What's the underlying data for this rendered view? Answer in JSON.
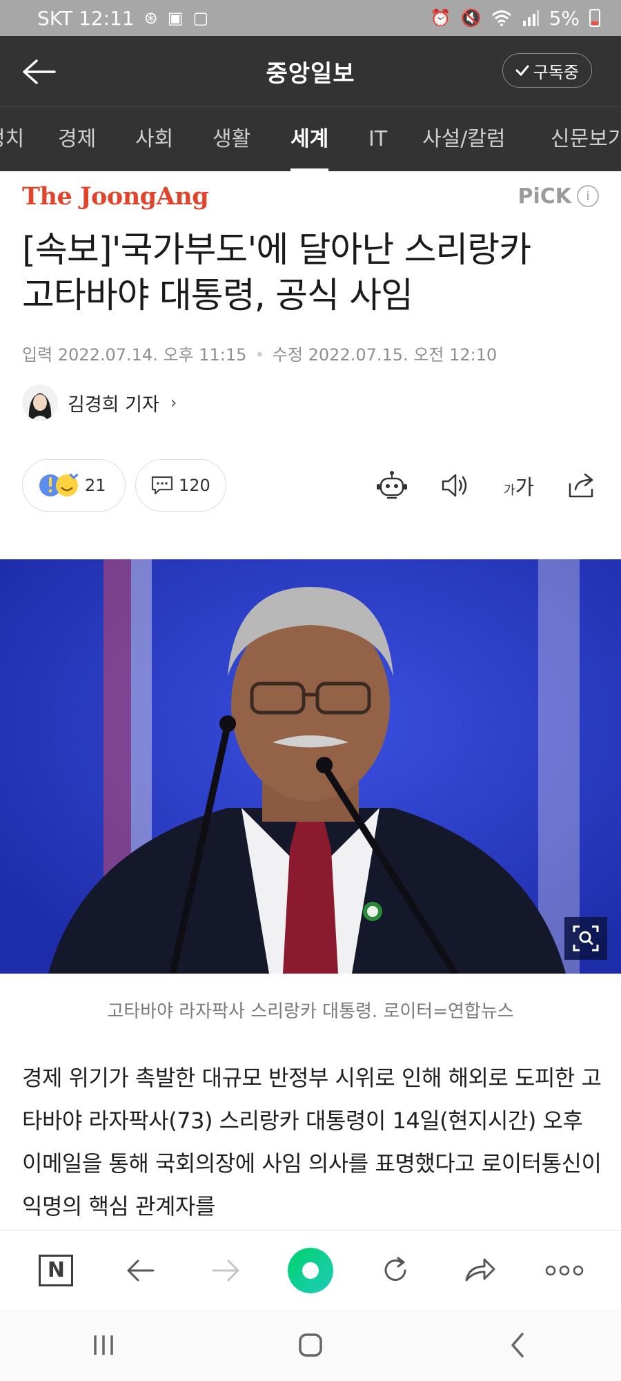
{
  "status_bar": {
    "carrier_time": "SKT 12:11",
    "battery": "5%"
  },
  "header": {
    "title": "중앙일보",
    "subscribe_label": "구독중"
  },
  "tabs": [
    {
      "label": "정치"
    },
    {
      "label": "경제"
    },
    {
      "label": "사회"
    },
    {
      "label": "생활"
    },
    {
      "label": "세계"
    },
    {
      "label": "IT"
    },
    {
      "label": "사설/칼럼"
    },
    {
      "label": "신문보기"
    }
  ],
  "active_tab": "세계",
  "article": {
    "publisher_logo": "The JoongAng",
    "pick_label": "PiCK",
    "headline_line1": "[속보]'국가부도'에 달아난 스리랑카",
    "headline_line2": "고타바야 대통령, 공식 사임",
    "input_date": "입력 2022.07.14. 오후 11:15",
    "edit_date": "수정 2022.07.15. 오전 12:10",
    "reporter": "김경희 기자",
    "reaction_count": "21",
    "comment_count": "120",
    "caption": "고타바야 라자팍사 스리랑카 대통령. 로이터=연합뉴스",
    "body": "경제 위기가 촉발한 대규모 반정부 시위로 인해 해외로 도피한 고타바야 라자팍사(73) 스리랑카 대통령이 14일(현지시간) 오후 이메일을 통해 국회의장에 사임 의사를 표명했다고 로이터통신이 익명의 핵심 관계자를"
  },
  "colors": {
    "header_bg": "#333333",
    "logo_red": "#e1442a",
    "status_bg": "#a7a7a7",
    "photo_bg": "#2a39d0",
    "naver_green": "#00d26a"
  }
}
